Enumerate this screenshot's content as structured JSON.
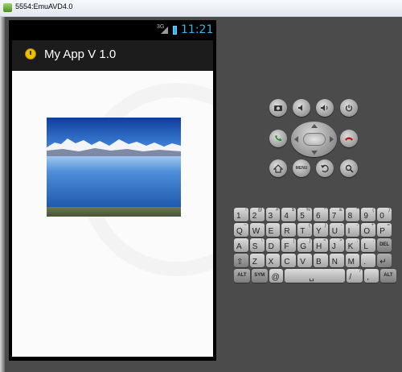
{
  "window": {
    "title": "5554:EmuAVD4.0"
  },
  "status_bar": {
    "network": "3G",
    "time": "11:21"
  },
  "app": {
    "title": "My App V 1.0"
  },
  "image": {
    "description_icon": "mountain-lake-image"
  },
  "controls": {
    "menu_label": "MENU"
  },
  "keyboard": {
    "row1": [
      {
        "main": "1",
        "alt": "!"
      },
      {
        "main": "2",
        "alt": "@"
      },
      {
        "main": "3",
        "alt": "#"
      },
      {
        "main": "4",
        "alt": "$"
      },
      {
        "main": "5",
        "alt": "%"
      },
      {
        "main": "6",
        "alt": "^"
      },
      {
        "main": "7",
        "alt": "&"
      },
      {
        "main": "8",
        "alt": "*"
      },
      {
        "main": "9",
        "alt": "("
      },
      {
        "main": "0",
        "alt": ")"
      }
    ],
    "row2": [
      {
        "main": "Q",
        "alt": "~"
      },
      {
        "main": "W",
        "alt": "\""
      },
      {
        "main": "E",
        "alt": "´"
      },
      {
        "main": "R",
        "alt": ""
      },
      {
        "main": "T",
        "alt": "{"
      },
      {
        "main": "Y",
        "alt": "}"
      },
      {
        "main": "U",
        "alt": "-"
      },
      {
        "main": "I",
        "alt": "-"
      },
      {
        "main": "O",
        "alt": "+"
      },
      {
        "main": "P",
        "alt": "="
      }
    ],
    "row3": [
      {
        "main": "A",
        "alt": ""
      },
      {
        "main": "S",
        "alt": "\\"
      },
      {
        "main": "D",
        "alt": ""
      },
      {
        "main": "F",
        "alt": "["
      },
      {
        "main": "G",
        "alt": "]"
      },
      {
        "main": "H",
        "alt": "<"
      },
      {
        "main": "J",
        "alt": ">"
      },
      {
        "main": "K",
        "alt": ";"
      },
      {
        "main": "L",
        "alt": ":"
      },
      {
        "main": "DEL",
        "alt": ""
      }
    ],
    "row4": [
      {
        "main": "⇧",
        "alt": ""
      },
      {
        "main": "Z",
        "alt": ""
      },
      {
        "main": "X",
        "alt": ""
      },
      {
        "main": "C",
        "alt": ""
      },
      {
        "main": "V",
        "alt": ""
      },
      {
        "main": "B",
        "alt": ""
      },
      {
        "main": "N",
        "alt": ""
      },
      {
        "main": "M",
        "alt": ""
      },
      {
        "main": ".",
        "alt": ""
      },
      {
        "main": "↵",
        "alt": ""
      }
    ],
    "row5": [
      {
        "main": "ALT",
        "alt": ""
      },
      {
        "main": "SYM",
        "alt": ""
      },
      {
        "main": "@",
        "alt": ""
      },
      {
        "main": "␣",
        "alt": ""
      },
      {
        "main": "/",
        "alt": "?"
      },
      {
        "main": ",",
        "alt": ""
      },
      {
        "main": "ALT",
        "alt": ""
      }
    ]
  }
}
